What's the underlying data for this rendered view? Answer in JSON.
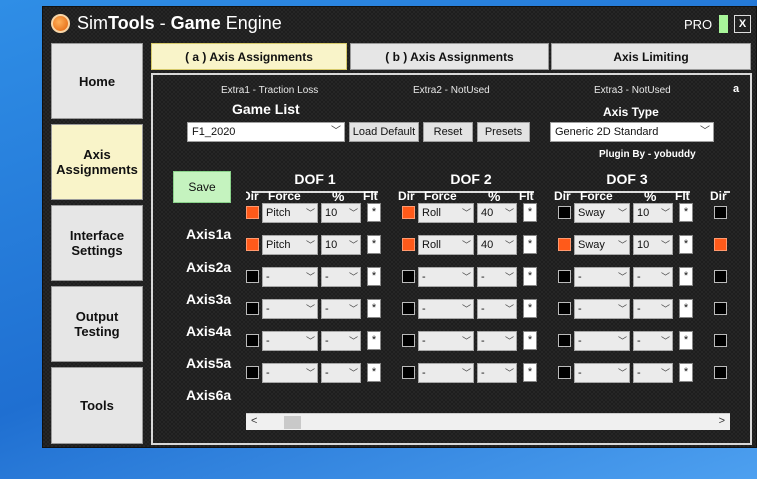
{
  "window": {
    "title_pre": "Sim",
    "title_bold1": "Tools",
    "title_mid": " - ",
    "title_bold2": "Game",
    "title_post": " Engine",
    "pro_label": "PRO",
    "close_label": "X"
  },
  "nav": {
    "home": "Home",
    "axis_assignments": "Axis Assignments",
    "interface_settings": "Interface Settings",
    "output_testing": "Output Testing",
    "tools": "Tools"
  },
  "tabs": {
    "a": "( a ) Axis Assignments",
    "b": "( b ) Axis Assignments",
    "limiting": "Axis Limiting"
  },
  "panel": {
    "corner_label": "a",
    "extra1": "Extra1 - Traction Loss",
    "extra2": "Extra2 - NotUsed",
    "extra3": "Extra3 - NotUsed",
    "game_list_label": "Game List",
    "game_selected": "F1_2020",
    "load_default": "Load Default",
    "reset": "Reset",
    "presets": "Presets",
    "axis_type_label": "Axis Type",
    "axis_type_selected": "Generic 2D Standard",
    "plugin_by": "Plugin By - yobuddy",
    "save": "Save"
  },
  "grid": {
    "dof_titles": [
      "DOF 1",
      "DOF 2",
      "DOF 3"
    ],
    "headers": {
      "dir": "Dir",
      "force": "Force",
      "pct": "%",
      "flt": "Flt"
    },
    "axes": [
      "Axis1a",
      "Axis2a",
      "Axis3a",
      "Axis4a",
      "Axis5a",
      "Axis6a"
    ],
    "flt_mark": "*",
    "rows": [
      [
        {
          "force": "Pitch",
          "pct": "10",
          "dir": true
        },
        {
          "force": "Roll",
          "pct": "40",
          "dir": true
        },
        {
          "force": "Sway",
          "pct": "10",
          "dir": false
        },
        {
          "dir": false
        }
      ],
      [
        {
          "force": "Pitch",
          "pct": "10",
          "dir": true
        },
        {
          "force": "Roll",
          "pct": "40",
          "dir": true
        },
        {
          "force": "Sway",
          "pct": "10",
          "dir": true
        },
        {
          "dir": true
        }
      ],
      [
        {
          "force": "-",
          "pct": "-",
          "dir": false
        },
        {
          "force": "-",
          "pct": "-",
          "dir": false
        },
        {
          "force": "-",
          "pct": "-",
          "dir": false
        },
        {
          "dir": false
        }
      ],
      [
        {
          "force": "-",
          "pct": "-",
          "dir": false
        },
        {
          "force": "-",
          "pct": "-",
          "dir": false
        },
        {
          "force": "-",
          "pct": "-",
          "dir": false
        },
        {
          "dir": false
        }
      ],
      [
        {
          "force": "-",
          "pct": "-",
          "dir": false
        },
        {
          "force": "-",
          "pct": "-",
          "dir": false
        },
        {
          "force": "-",
          "pct": "-",
          "dir": false
        },
        {
          "dir": false
        }
      ],
      [
        {
          "force": "-",
          "pct": "-",
          "dir": false
        },
        {
          "force": "-",
          "pct": "-",
          "dir": false
        },
        {
          "force": "-",
          "pct": "-",
          "dir": false
        },
        {
          "dir": false
        }
      ]
    ]
  },
  "colors": {
    "dir_on": "#ff5a1a",
    "save_green": "#c5f3bf",
    "active_tab": "#f9f4c9"
  },
  "icons": {
    "app_logo": "simtools-logo-icon",
    "dropdown": "chevron-down-icon",
    "scroll_left": "scroll-left-icon",
    "scroll_right": "scroll-right-icon"
  }
}
